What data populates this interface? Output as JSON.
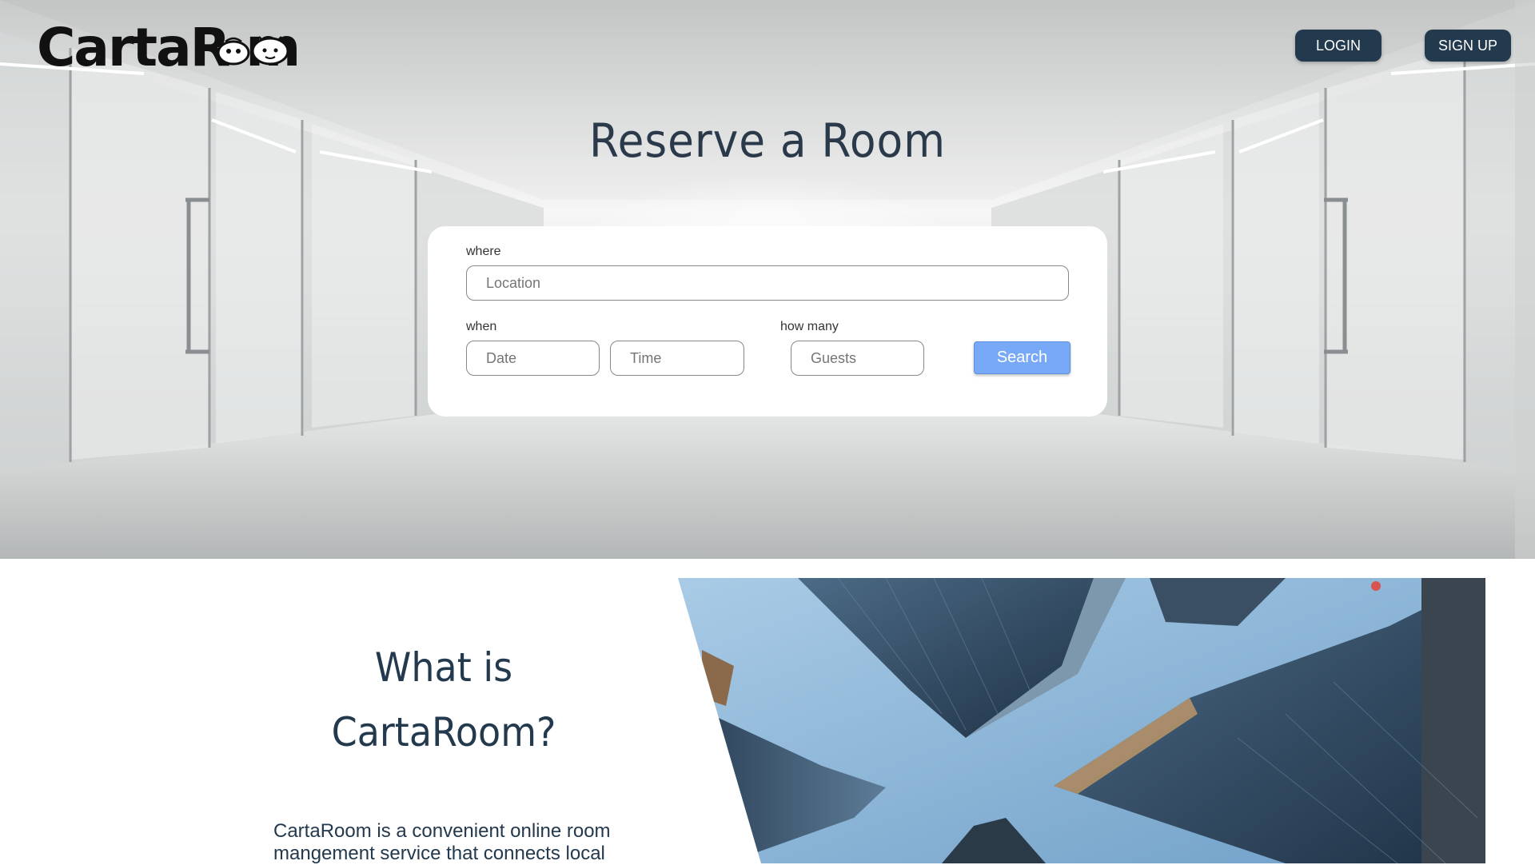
{
  "brand": {
    "name": "CartaRoom",
    "logo_text": "CartaR   m"
  },
  "nav": {
    "login_label": "LOGIN",
    "signup_label": "SIGN UP"
  },
  "hero": {
    "title": "Reserve a Room",
    "where_label": "where",
    "location_placeholder": "Location",
    "when_label": "when",
    "date_placeholder": "Date",
    "time_placeholder": "Time",
    "how_many_label": "how many",
    "guests_placeholder": "Guests",
    "search_label": "Search"
  },
  "about": {
    "title_line1": "What is",
    "title_line2": "CartaRoom?",
    "text": "CartaRoom is a convenient online room mangement service that connects local"
  },
  "colors": {
    "primary_dark": "#23394d",
    "search_button": "#78a9f6",
    "card_background": "#ffffff"
  },
  "icons": {
    "logo_faces": "cartoon-faces-icon",
    "about_image": "skyscrapers-photo"
  }
}
